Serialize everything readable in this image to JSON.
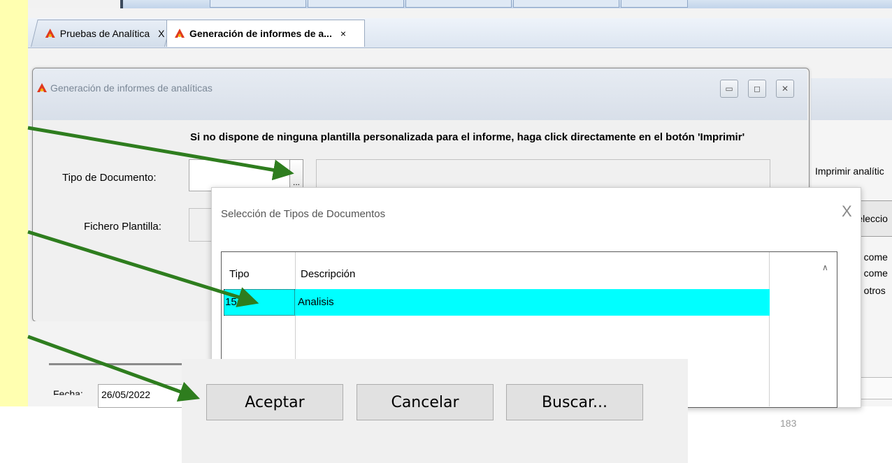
{
  "tabs": [
    {
      "label": "Pruebas de Analítica",
      "close": "X"
    },
    {
      "label": "Generación de informes de a...",
      "close": "×"
    }
  ],
  "window": {
    "title": "Generación de informes de analíticas",
    "controls": {
      "minimize": "▭",
      "maximize": "◻",
      "close": "✕"
    }
  },
  "form": {
    "instruction": "Si no dispone de ninguna plantilla personalizada para el informe, haga click directamente en el botón 'Imprimir'",
    "tipo_label": "Tipo de Documento:",
    "fichero_label": "Fichero Plantilla:",
    "browse_label": "..."
  },
  "right_panel": {
    "imprimir": "Imprimir analític",
    "seleccio": "Seleccio",
    "item1": "ir come",
    "item2": "ir come",
    "item3": "ir otros"
  },
  "lower": {
    "fecha_label": "Fecha:",
    "fecha_value": "26/05/2022"
  },
  "dialog": {
    "title": "Selección de Tipos de Documentos",
    "close": "X",
    "columns": [
      "Tipo",
      "Descripción"
    ],
    "rows": [
      {
        "tipo": "15",
        "descripcion": "Analisis",
        "selected": true
      }
    ],
    "scroll_up": "∧",
    "buttons": {
      "accept": "Aceptar",
      "cancel": "Cancelar",
      "search": "Buscar..."
    }
  },
  "annotations": {
    "arrow_color": "#2e7d1e"
  },
  "page_number": "183",
  "colors": {
    "selection": "#00ffff",
    "left_strip": "#ffffb0"
  }
}
